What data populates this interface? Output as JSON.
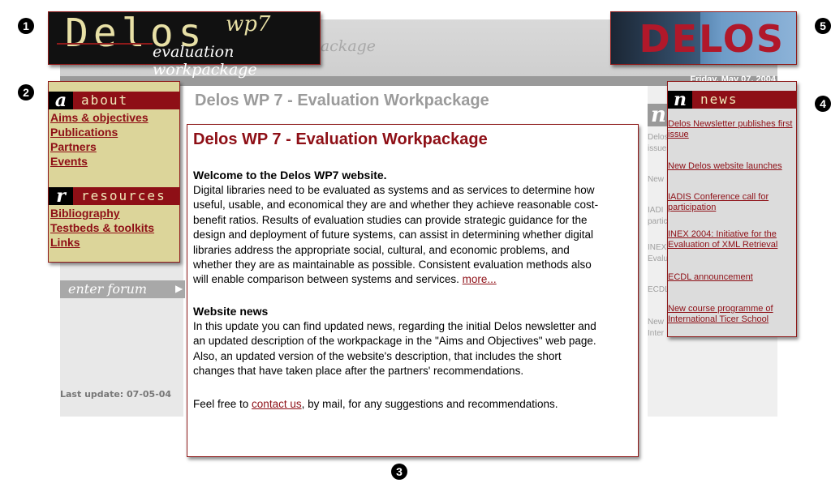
{
  "background": {
    "header_subtitle_ghost": "evaluation workpackage",
    "date": "Friday, May 07, 2004",
    "heading_ghost": "Delos WP 7 - Evaluation Workpackage",
    "forum_label": "enter forum",
    "last_update": "Last update: 07-05-04",
    "news_ghost_items": [
      "Delos",
      "issue",
      "New",
      "IADI",
      "partic",
      "INEX",
      "Evalu",
      "ECDL",
      "New",
      "Inter"
    ]
  },
  "logo": {
    "title": "Delos",
    "wp": "wp7",
    "subtitle": "evaluation workpackage"
  },
  "delos_image": {
    "text": "DELOS"
  },
  "left_panel": {
    "about": {
      "letter": "a",
      "title": "about",
      "links": [
        "Aims & objectives",
        "Publications",
        "Partners",
        "Events"
      ]
    },
    "resources": {
      "letter": "r",
      "title": "resources",
      "links": [
        "Bibliography",
        "Testbeds & toolkits",
        "Links"
      ]
    }
  },
  "news_panel": {
    "letter": "n",
    "title": "news",
    "items": [
      {
        "line1": "Delos Newsletter publishes first",
        "line2": "issue"
      },
      {
        "line1": "New Delos website launches",
        "line2": ""
      },
      {
        "line1": "IADIS Conference call for",
        "line2": "participation"
      },
      {
        "line1": "INEX 2004: Initiative for the",
        "line2": "Evaluation of XML Retrieval"
      },
      {
        "line1": "ECDL announcement",
        "line2": ""
      },
      {
        "line1": "New course programme of",
        "line2": "International Ticer School"
      }
    ]
  },
  "main": {
    "title": "Delos WP 7 - Evaluation Workpackage",
    "welcome_heading": "Welcome to the Delos WP7 website.",
    "welcome_lines": [
      "Digital libraries need to be evaluated as systems and as services to determine how",
      "useful, usable, and economical they are and whether they achieve reasonable cost-",
      "benefit ratios. Results of evaluation studies can provide strategic guidance for the",
      "design and deployment of future systems, can assist in determining whether digital",
      "libraries address the appropriate social, cultural, and economic problems, and",
      "whether they are as maintainable as possible. Consistent evaluation methods also",
      "will enable comparison between systems and services."
    ],
    "more_link": "more...",
    "news_heading": "Website news",
    "news_lines": [
      "In this update you can find updated news, regarding the initial Delos newsletter and",
      "an updated description of the workpackage in the \"Aims and Objectives\" web page.",
      "Also, an updated version of the website's description, that includes the short",
      "changes that have taken place after the partners' recommendations."
    ],
    "contact_before": "Feel free to ",
    "contact_link": "contact us",
    "contact_after": ", by mail, for any suggestions and recommendations."
  },
  "markers": [
    "1",
    "2",
    "3",
    "4",
    "5"
  ]
}
